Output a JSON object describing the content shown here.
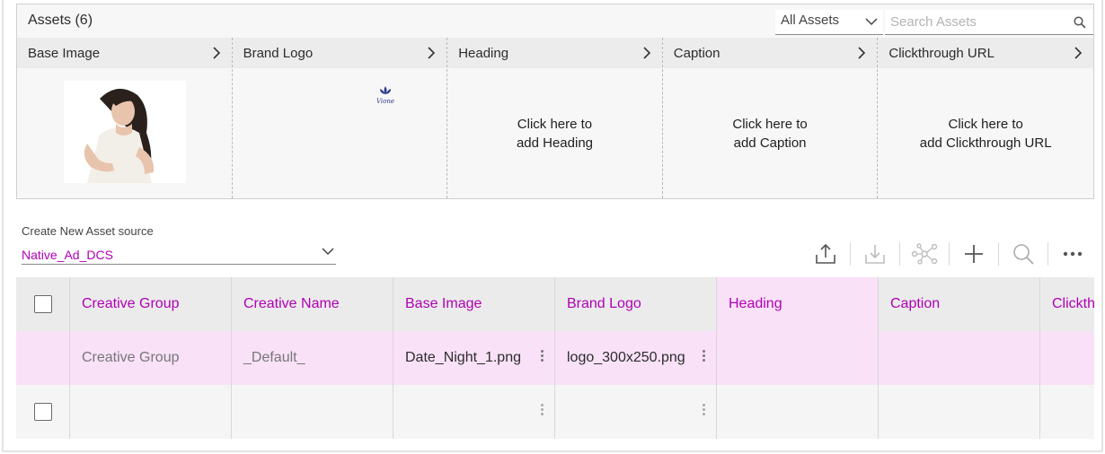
{
  "assets": {
    "title": "Assets (6)",
    "filter_value": "All Assets",
    "search_placeholder": "Search Assets",
    "cards": [
      {
        "label": "Base Image",
        "body": ""
      },
      {
        "label": "Brand Logo",
        "body": ""
      },
      {
        "label": "Heading",
        "body_line1": "Click here to",
        "body_line2": "add Heading"
      },
      {
        "label": "Caption",
        "body_line1": "Click here to",
        "body_line2": "add Caption"
      },
      {
        "label": "Clickthrough URL",
        "body_line1": "Click here to",
        "body_line2": "add Clickthrough URL"
      }
    ],
    "logo_text": "Vione"
  },
  "source": {
    "label": "Create New Asset source",
    "value": "Native_Ad_DCS"
  },
  "toolbar": [
    "upload-icon",
    "download-icon",
    "network-icon",
    "plus-icon",
    "search-icon",
    "more-icon"
  ],
  "grid": {
    "headers": [
      "Creative Group",
      "Creative Name",
      "Base Image",
      "Brand Logo",
      "Heading",
      "Caption",
      "Clickth"
    ],
    "rows": [
      {
        "cells": [
          "Creative Group",
          "_Default_",
          "Date_Night_1.png",
          "logo_300x250.png",
          "",
          "",
          ""
        ]
      },
      {
        "cells": [
          "",
          "",
          "",
          "",
          "",
          "",
          ""
        ]
      }
    ]
  },
  "colors": {
    "accent": "#b000b5",
    "selected_row": "#f9e1f8",
    "header_bg": "#ebebeb"
  }
}
